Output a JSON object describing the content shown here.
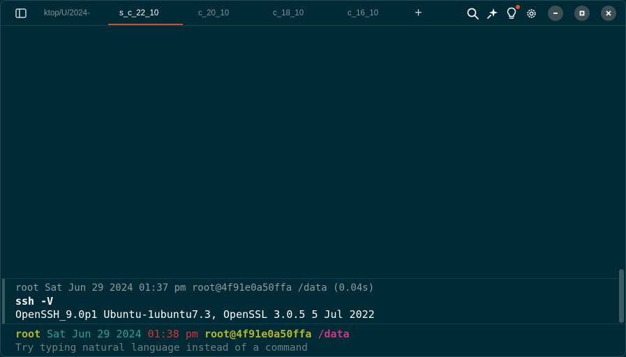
{
  "tabs": [
    {
      "label": "ktop/U/2024-",
      "active": false
    },
    {
      "label": "s_c_22_10",
      "active": true
    },
    {
      "label": "c_20_10",
      "active": false
    },
    {
      "label": "c_18_10",
      "active": false
    },
    {
      "label": "c_16_10",
      "active": false
    }
  ],
  "toolbar": {
    "new_tab_label": "+",
    "icons": [
      "search-icon",
      "sparkle-icon",
      "lightbulb-icon",
      "gear-icon"
    ],
    "accent": "#c9532b"
  },
  "block": {
    "meta": "root Sat Jun 29 2024 01:37 pm root@4f91e0a50ffa /data (0.04s)",
    "command": "ssh -V",
    "output": "OpenSSH_9.0p1 Ubuntu-1ubuntu7.3, OpenSSL 3.0.5 5 Jul 2022"
  },
  "prompt": {
    "user": "root",
    "date": "Sat Jun 29 2024",
    "time": "01:38 pm",
    "host": "root@4f91e0a50ffa",
    "dir": "/data",
    "placeholder": "Try typing natural language instead of a command"
  },
  "colors": {
    "background": "#002b36",
    "user": "#b5b520",
    "date": "#2aa198",
    "time": "#dc322f",
    "dir": "#d33682"
  }
}
